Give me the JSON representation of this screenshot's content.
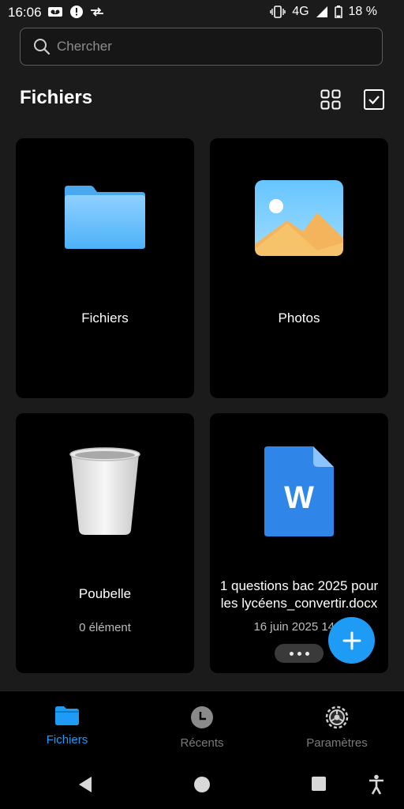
{
  "status_bar": {
    "time": "16:06",
    "network": "4G",
    "battery": "18 %",
    "icons": [
      "voicemail-icon",
      "info-circle-icon",
      "data-transfer-icon",
      "vibrate-icon",
      "signal-icon",
      "battery-icon"
    ]
  },
  "search": {
    "placeholder": "Chercher",
    "value": ""
  },
  "header": {
    "title": "Fichiers"
  },
  "cards": {
    "files": {
      "label": "Fichiers",
      "icon": "folder-icon"
    },
    "photos": {
      "label": "Photos",
      "icon": "photo-icon"
    },
    "trash": {
      "label": "Poubelle",
      "sub": "0 élément",
      "icon": "trash-icon"
    },
    "recent_doc": {
      "name": "1 questions bac 2025 pour les lycéens_convertir.docx",
      "date": "16 juin 2025 14:0",
      "icon": "word-document-icon"
    }
  },
  "fab": {
    "icon": "plus-icon"
  },
  "bottom_nav": {
    "items": [
      {
        "label": "Fichiers",
        "icon": "folder-icon",
        "active": true
      },
      {
        "label": "Récents",
        "icon": "clock-icon",
        "active": false
      },
      {
        "label": "Paramètres",
        "icon": "gear-icon",
        "active": false
      }
    ]
  },
  "colors": {
    "accent": "#1e9bf5",
    "background": "#1b1b1b",
    "card": "#000000",
    "inactive_text": "#7a7a7a"
  }
}
